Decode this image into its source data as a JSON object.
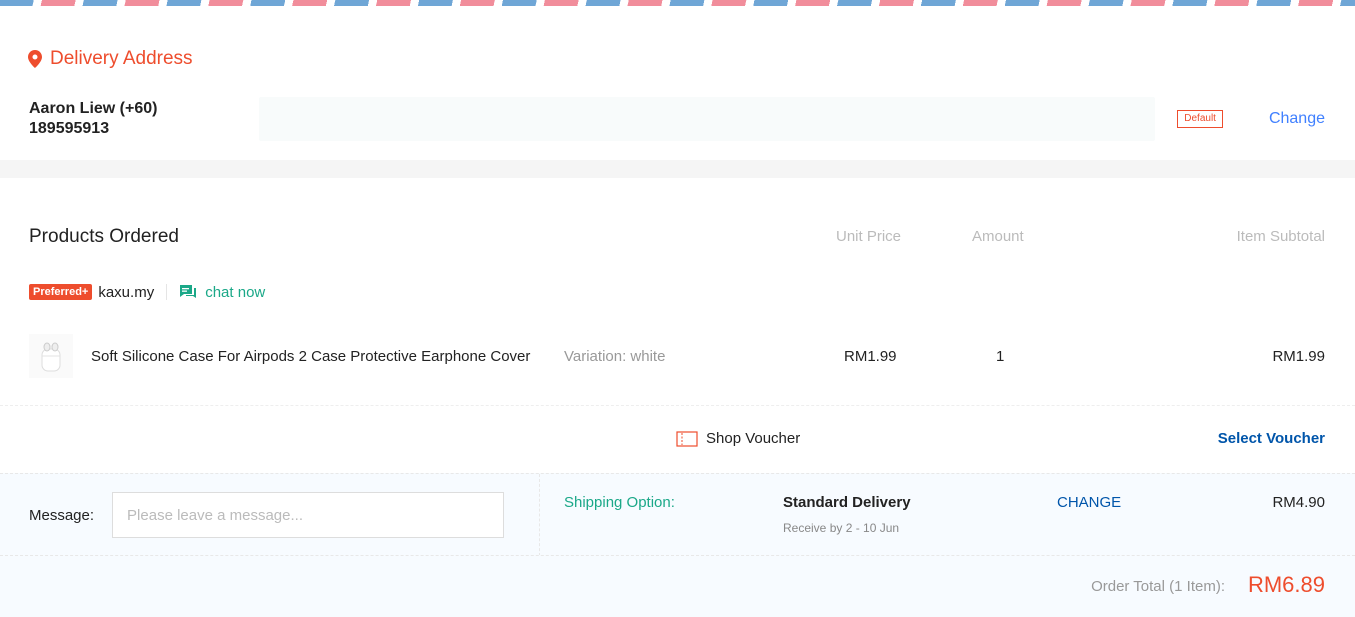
{
  "address": {
    "title": "Delivery Address",
    "name_line1": "Aaron Liew (+60)",
    "name_line2": "189595913",
    "default_badge": "Default",
    "change_label": "Change"
  },
  "products": {
    "title": "Products Ordered",
    "columns": {
      "unit_price": "Unit Price",
      "amount": "Amount",
      "subtotal": "Item Subtotal"
    },
    "shop": {
      "badge": "Preferred+",
      "name": "kaxu.my",
      "chat_label": "chat now"
    },
    "item": {
      "name": "Soft Silicone Case For Airpods 2 Case Protective Earphone Cover",
      "variation": "Variation: white",
      "unit_price": "RM1.99",
      "amount": "1",
      "subtotal": "RM1.99"
    },
    "voucher": {
      "label": "Shop Voucher",
      "select_label": "Select Voucher"
    }
  },
  "message": {
    "label": "Message:",
    "placeholder": "Please leave a message..."
  },
  "shipping": {
    "label": "Shipping Option:",
    "name": "Standard Delivery",
    "eta": "Receive by 2 - 10 Jun",
    "change_label": "CHANGE",
    "price": "RM4.90"
  },
  "total": {
    "label": "Order Total (1 Item):",
    "value": "RM6.89"
  },
  "colors": {
    "brand": "#ee4d2d",
    "chat": "#1ba888",
    "link": "#0055aa",
    "change": "#4080ff"
  }
}
